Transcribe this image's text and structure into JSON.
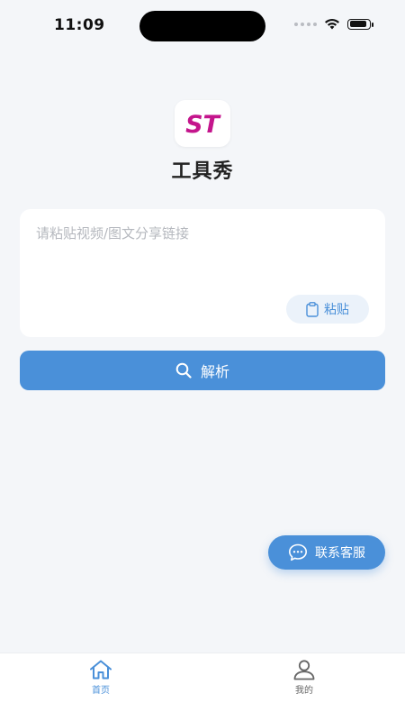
{
  "status_bar": {
    "time": "11:09"
  },
  "app": {
    "logo_text": "ST",
    "name": "工具秀"
  },
  "input": {
    "placeholder": "请粘贴视频/图文分享链接",
    "value": ""
  },
  "paste_button": {
    "label": "粘贴"
  },
  "parse_button": {
    "label": "解析"
  },
  "support_button": {
    "label": "联系客服"
  },
  "tabs": [
    {
      "label": "首页",
      "active": true
    },
    {
      "label": "我的",
      "active": false
    }
  ],
  "colors": {
    "accent": "#4a90d9",
    "background": "#f4f6f9",
    "logo_magenta": "#c4158c"
  }
}
